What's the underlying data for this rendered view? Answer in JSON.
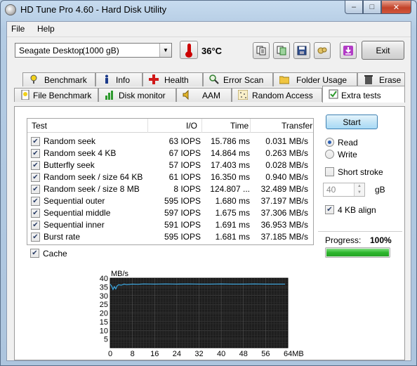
{
  "window": {
    "title": "HD Tune Pro 4.60 - Hard Disk Utility",
    "minimize": "–",
    "maximize": "□",
    "close": "✕"
  },
  "menu": {
    "file": "File",
    "help": "Help"
  },
  "toolbar": {
    "drive_name": "Seagate Desktop",
    "drive_capacity": "(1000 gB)",
    "temperature": "36°C",
    "exit_label": "Exit",
    "icons": [
      "copy-text-icon",
      "copy-screenshot-icon",
      "save-icon",
      "options-icon",
      "download-icon"
    ]
  },
  "tabs_row1": [
    {
      "label": "Benchmark",
      "icon": "benchmark-icon"
    },
    {
      "label": "Info",
      "icon": "info-icon"
    },
    {
      "label": "Health",
      "icon": "health-icon"
    },
    {
      "label": "Error Scan",
      "icon": "error-scan-icon"
    },
    {
      "label": "Folder Usage",
      "icon": "folder-icon"
    },
    {
      "label": "Erase",
      "icon": "erase-icon"
    }
  ],
  "tabs_row2": [
    {
      "label": "File Benchmark",
      "icon": "file-benchmark-icon"
    },
    {
      "label": "Disk monitor",
      "icon": "disk-monitor-icon"
    },
    {
      "label": "AAM",
      "icon": "aam-icon"
    },
    {
      "label": "Random Access",
      "icon": "random-access-icon"
    },
    {
      "label": "Extra tests",
      "icon": "extra-tests-icon",
      "active": true
    }
  ],
  "results": {
    "headers": {
      "test": "Test",
      "io": "I/O",
      "time": "Time",
      "transfer": "Transfer"
    },
    "rows": [
      {
        "test": "Random seek",
        "io": "63 IOPS",
        "time": "15.786 ms",
        "transfer": "0.031 MB/s",
        "checked": true
      },
      {
        "test": "Random seek 4 KB",
        "io": "67 IOPS",
        "time": "14.864 ms",
        "transfer": "0.263 MB/s",
        "checked": true
      },
      {
        "test": "Butterfly seek",
        "io": "57 IOPS",
        "time": "17.403 ms",
        "transfer": "0.028 MB/s",
        "checked": true
      },
      {
        "test": "Random seek / size 64 KB",
        "io": "61 IOPS",
        "time": "16.350 ms",
        "transfer": "0.940 MB/s",
        "checked": true
      },
      {
        "test": "Random seek / size 8 MB",
        "io": "8 IOPS",
        "time": "124.807 ...",
        "transfer": "32.489 MB/s",
        "checked": true
      },
      {
        "test": "Sequential outer",
        "io": "595 IOPS",
        "time": "1.680 ms",
        "transfer": "37.197 MB/s",
        "checked": true
      },
      {
        "test": "Sequential middle",
        "io": "597 IOPS",
        "time": "1.675 ms",
        "transfer": "37.306 MB/s",
        "checked": true
      },
      {
        "test": "Sequential inner",
        "io": "591 IOPS",
        "time": "1.691 ms",
        "transfer": "36.953 MB/s",
        "checked": true
      },
      {
        "test": "Burst rate",
        "io": "595 IOPS",
        "time": "1.681 ms",
        "transfer": "37.185 MB/s",
        "checked": true
      }
    ]
  },
  "controls": {
    "start_label": "Start",
    "read_label": "Read",
    "write_label": "Write",
    "mode": "read",
    "short_stroke_label": "Short stroke",
    "short_stroke_checked": false,
    "short_stroke_value": "40",
    "short_stroke_unit": "gB",
    "align_label": "4 KB align",
    "align_checked": true,
    "cache_label": "Cache",
    "cache_checked": true,
    "progress_label": "Progress:",
    "progress_value": "100%",
    "progress_fraction": 1.0
  },
  "chart_data": {
    "type": "line",
    "ylabel": "MB/s",
    "xlabel": "",
    "y_ticks": [
      "5",
      "10",
      "15",
      "20",
      "25",
      "30",
      "35",
      "40"
    ],
    "x_ticks": [
      "0",
      "8",
      "16",
      "24",
      "32",
      "40",
      "48",
      "56",
      "64MB"
    ],
    "xlim": [
      0,
      64
    ],
    "ylim": [
      0,
      40
    ],
    "grid": true,
    "series": [
      {
        "color": "#3aa6e0",
        "x": [
          0,
          0.5,
          1,
          1.5,
          2,
          2.5,
          3,
          4,
          5,
          6,
          8,
          10,
          12,
          16,
          20,
          24,
          28,
          32,
          36,
          40,
          44,
          48,
          52,
          56,
          60,
          63
        ],
        "y": [
          36.5,
          35.5,
          33.5,
          35.2,
          33.8,
          35.6,
          36.2,
          36.0,
          36.6,
          36.3,
          36.6,
          36.5,
          36.7,
          36.6,
          36.7,
          36.6,
          36.7,
          36.6,
          36.6,
          36.7,
          36.6,
          36.6,
          36.7,
          36.6,
          36.6,
          36.6
        ]
      }
    ]
  }
}
